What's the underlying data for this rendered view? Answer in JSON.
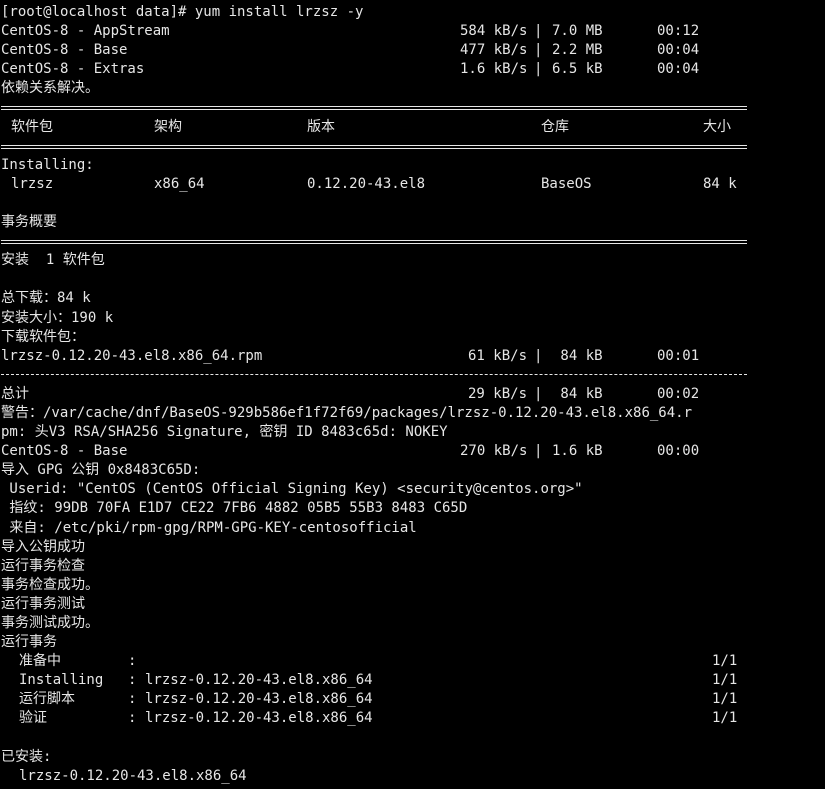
{
  "terminal": {
    "prompt": "[root@localhost data]# yum install lrzsz -y",
    "repos": [
      {
        "name": "CentOS-8 - AppStream",
        "speed": "584 kB/s",
        "size": "7.0 MB",
        "time": "00:12"
      },
      {
        "name": "CentOS-8 - Base",
        "speed": "477 kB/s",
        "size": "2.2 MB",
        "time": "00:04"
      },
      {
        "name": "CentOS-8 - Extras",
        "speed": "1.6 kB/s",
        "size": "6.5 kB",
        "time": "00:04"
      }
    ],
    "deps_resolved": "依赖关系解决。",
    "table_headers": {
      "package": "软件包",
      "arch": "架构",
      "version": "版本",
      "repo": "仓库",
      "size": "大小"
    },
    "installing_label": "Installing:",
    "package_row": {
      "name": "lrzsz",
      "arch": "x86_64",
      "version": "0.12.20-43.el8",
      "repo": "BaseOS",
      "size": "84 k"
    },
    "transaction_summary": "事务概要",
    "install_count": "安装  1 软件包",
    "total_download": "总下载：84 k",
    "installed_size": "安装大小：190 k",
    "downloading_packages": "下载软件包：",
    "rpm_download": {
      "file": "lrzsz-0.12.20-43.el8.x86_64.rpm",
      "speed": "61 kB/s",
      "size": " 84 kB",
      "time": "00:01"
    },
    "total_row": {
      "label": "总计",
      "speed": "29 kB/s",
      "size": " 84 kB",
      "time": "00:02"
    },
    "warning_line1": "警告：/var/cache/dnf/BaseOS-929b586ef1f72f69/packages/lrzsz-0.12.20-43.el8.x86_64.r",
    "warning_line2": "pm: 头V3 RSA/SHA256 Signature, 密钥 ID 8483c65d: NOKEY",
    "base_row": {
      "name": "CentOS-8 - Base",
      "speed": "270 kB/s",
      "size": "1.6 kB",
      "time": "00:00"
    },
    "gpg_import": "导入 GPG 公钥 0x8483C65D:",
    "userid": " Userid: \"CentOS (CentOS Official Signing Key) <security@centos.org>\"",
    "fingerprint": " 指纹: 99DB 70FA E1D7 CE22 7FB6 4882 05B5 55B3 8483 C65D",
    "from": " 来自: /etc/pki/rpm-gpg/RPM-GPG-KEY-centosofficial",
    "status_lines": [
      "导入公钥成功",
      "运行事务检查",
      "事务检查成功。",
      "运行事务测试",
      "事务测试成功。",
      "运行事务"
    ],
    "steps": [
      {
        "label": "准备中",
        "pkg": "",
        "progress": "1/1"
      },
      {
        "label": "Installing",
        "pkg": "lrzsz-0.12.20-43.el8.x86_64",
        "progress": "1/1"
      },
      {
        "label": "运行脚本",
        "pkg": "lrzsz-0.12.20-43.el8.x86_64",
        "progress": "1/1"
      },
      {
        "label": "验证",
        "pkg": "lrzsz-0.12.20-43.el8.x86_64",
        "progress": "1/1"
      }
    ],
    "installed_label": "已安装:",
    "installed_pkg": "lrzsz-0.12.20-43.el8.x86_64"
  }
}
